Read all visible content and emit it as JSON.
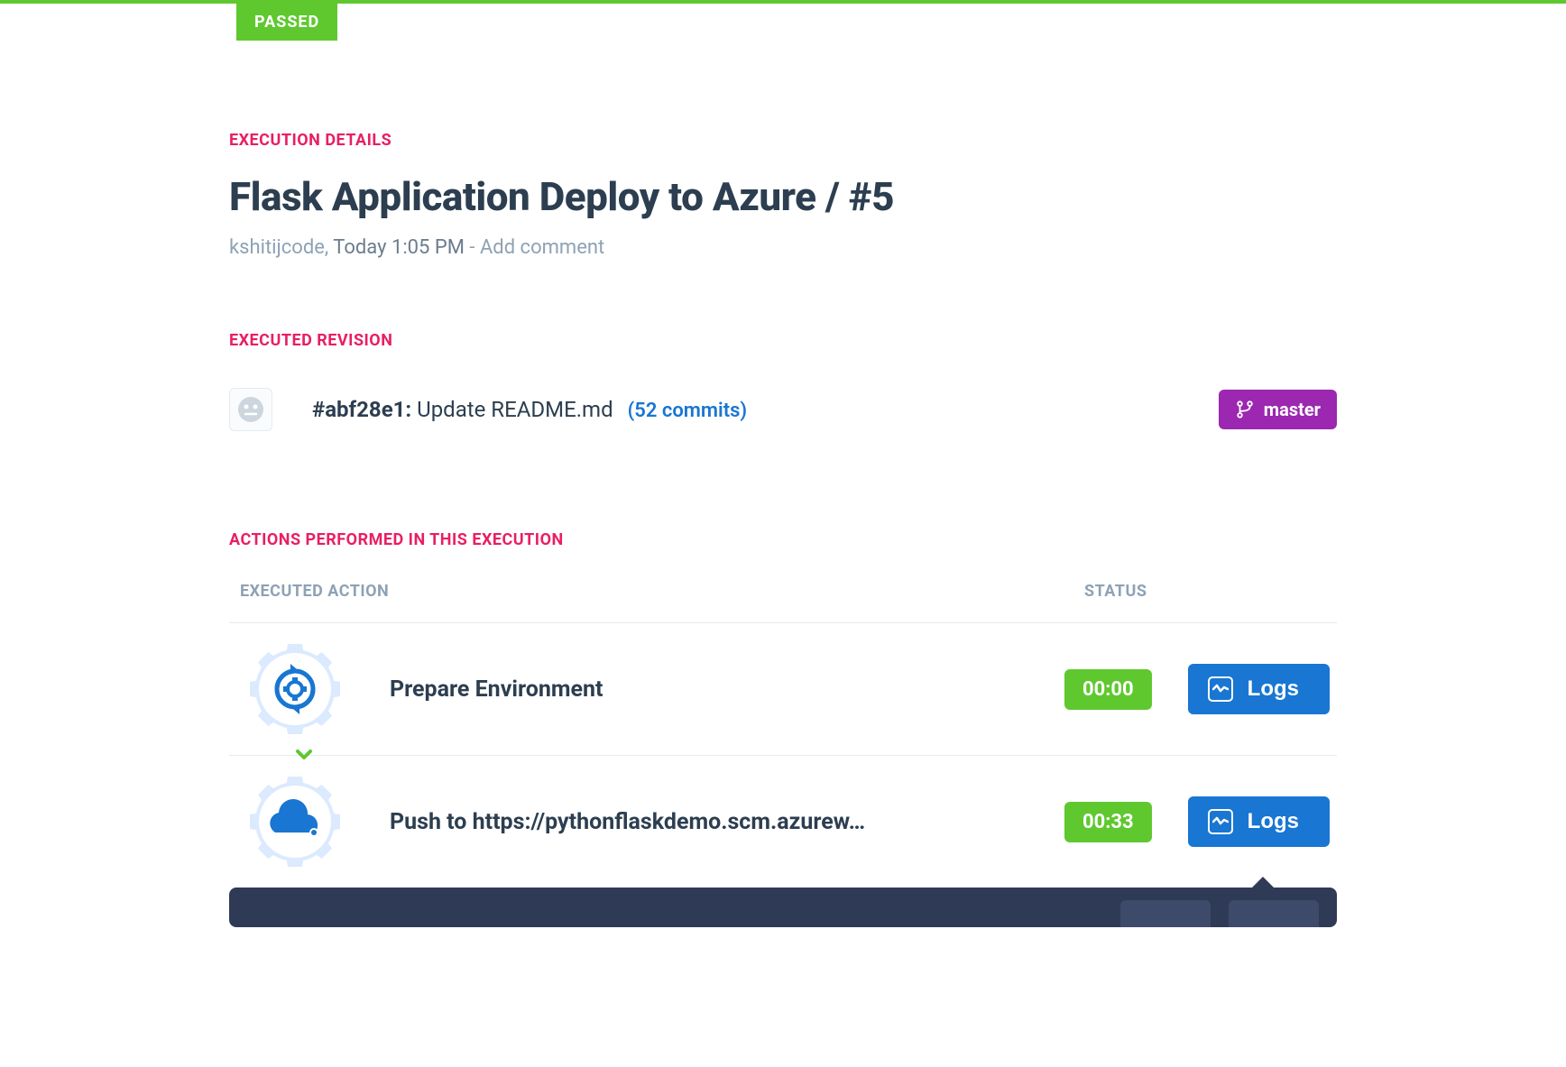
{
  "status_badge": "PASSED",
  "sections": {
    "execution_details_label": "EXECUTION DETAILS",
    "executed_revision_label": "EXECUTED REVISION",
    "actions_label": "ACTIONS PERFORMED IN THIS EXECUTION"
  },
  "header": {
    "title": "Flask Application Deploy to Azure / #5",
    "author": "kshitijcode",
    "separator": ", ",
    "timestamp": "Today 1:05 PM",
    "dash": " - ",
    "add_comment": "Add comment"
  },
  "revision": {
    "hash": "#abf28e1:",
    "message": " Update README.md",
    "commits_link": "(52 commits)",
    "branch": "master"
  },
  "table": {
    "header_action": "EXECUTED ACTION",
    "header_status": "STATUS"
  },
  "actions": [
    {
      "name": "Prepare Environment",
      "duration": "00:00",
      "logs_label": "Logs",
      "icon": "gear"
    },
    {
      "name": "Push to https://pythonflaskdemo.scm.azurew…",
      "duration": "00:33",
      "logs_label": "Logs",
      "icon": "azure"
    }
  ]
}
